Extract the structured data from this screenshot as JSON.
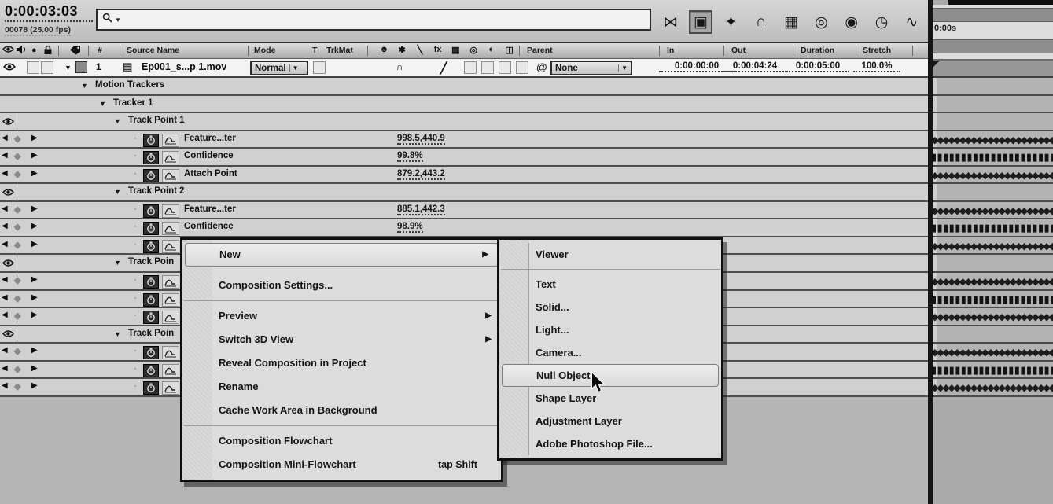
{
  "topbar": {
    "timecode": "0:00:03:03",
    "frames": "00078 (25.00 fps)",
    "search_placeholder": "",
    "tools": [
      {
        "name": "mini-flowchart-icon",
        "glyph": "⋈"
      },
      {
        "name": "live-update-icon",
        "glyph": "▣",
        "active": true
      },
      {
        "name": "draft-3d-icon",
        "glyph": "✦"
      },
      {
        "name": "shy-icon",
        "glyph": "∩"
      },
      {
        "name": "frame-blending-icon",
        "glyph": "▦"
      },
      {
        "name": "motion-blur-icon",
        "glyph": "◎"
      },
      {
        "name": "brainstorm-icon",
        "glyph": "◉"
      },
      {
        "name": "auto-keyframe-icon",
        "glyph": "◷"
      },
      {
        "name": "graph-editor-icon",
        "glyph": "∿"
      }
    ]
  },
  "columns": {
    "number": "#",
    "source_name": "Source Name",
    "mode": "Mode",
    "t": "T",
    "trkmat": "TrkMat",
    "parent": "Parent",
    "in": "In",
    "out": "Out",
    "duration": "Duration",
    "stretch": "Stretch",
    "switch_icons": [
      {
        "name": "shy-icon",
        "glyph": "☻"
      },
      {
        "name": "collapse-icon",
        "glyph": "✱"
      },
      {
        "name": "quality-icon",
        "glyph": "╲"
      },
      {
        "name": "fx-icon",
        "glyph": "fx"
      },
      {
        "name": "frame-blend-icon",
        "glyph": "▦"
      },
      {
        "name": "motion-blur-icon",
        "glyph": "◎"
      },
      {
        "name": "adjustment-layer-icon",
        "glyph": "◐"
      },
      {
        "name": "3d-layer-icon",
        "glyph": "◫"
      }
    ]
  },
  "layer": {
    "number": "1",
    "name": "Ep001_s...p 1.mov",
    "mode": "Normal",
    "parent": "None",
    "in": "0:00:00:00",
    "out": "0:00:04:24",
    "duration": "0:00:05:00",
    "stretch": "100.0%"
  },
  "rows": [
    {
      "type": "group",
      "level": 2,
      "label": "Motion Trackers"
    },
    {
      "type": "group",
      "level": 3,
      "label": "Tracker 1"
    },
    {
      "type": "group",
      "level": 4,
      "label": "Track Point 1",
      "eye": true
    },
    {
      "type": "prop",
      "label": "Feature...ter",
      "value": "998.5,440.9",
      "keyframes": "diamond"
    },
    {
      "type": "prop",
      "label": "Confidence",
      "value": "99.8%",
      "keyframes": "square"
    },
    {
      "type": "prop",
      "label": "Attach Point",
      "value": "879.2,443.2",
      "keyframes": "diamond"
    },
    {
      "type": "group",
      "level": 4,
      "label": "Track Point 2",
      "eye": true
    },
    {
      "type": "prop",
      "label": "Feature...ter",
      "value": "885.1,442.3",
      "keyframes": "diamond"
    },
    {
      "type": "prop",
      "label": "Confidence",
      "value": "98.9%",
      "keyframes": "square"
    },
    {
      "type": "prop",
      "label": "",
      "value": "",
      "keyframes": "diamond"
    },
    {
      "type": "group",
      "level": 4,
      "label": "Track Poin",
      "eye": true
    },
    {
      "type": "prop",
      "label": "",
      "value": "",
      "keyframes": "diamond"
    },
    {
      "type": "prop",
      "label": "",
      "value": "",
      "keyframes": "square"
    },
    {
      "type": "prop",
      "label": "",
      "value": "",
      "keyframes": "diamond"
    },
    {
      "type": "group",
      "level": 4,
      "label": "Track Poin",
      "eye": true
    },
    {
      "type": "prop",
      "label": "",
      "value": "",
      "keyframes": "diamond"
    },
    {
      "type": "prop",
      "label": "",
      "value": "",
      "keyframes": "square"
    },
    {
      "type": "prop",
      "label": "",
      "value": "",
      "keyframes": "diamond"
    }
  ],
  "context_menu": {
    "items": [
      {
        "label": "New",
        "submenu": true,
        "selected": true
      },
      {
        "separator": true
      },
      {
        "label": "Composition Settings..."
      },
      {
        "separator": true
      },
      {
        "label": "Preview",
        "submenu": true
      },
      {
        "label": "Switch 3D View",
        "submenu": true
      },
      {
        "label": "Reveal Composition in Project"
      },
      {
        "label": "Rename"
      },
      {
        "label": "Cache Work Area in Background"
      },
      {
        "separator": true
      },
      {
        "label": "Composition Flowchart"
      },
      {
        "label": "Composition Mini-Flowchart",
        "shortcut": "tap Shift"
      }
    ]
  },
  "submenu": {
    "items": [
      {
        "label": "Viewer"
      },
      {
        "separator": true
      },
      {
        "label": "Text"
      },
      {
        "label": "Solid..."
      },
      {
        "label": "Light..."
      },
      {
        "label": "Camera..."
      },
      {
        "label": "Null Object",
        "selected": true
      },
      {
        "label": "Shape Layer"
      },
      {
        "label": "Adjustment Layer"
      },
      {
        "label": "Adobe Photoshop File..."
      }
    ]
  },
  "ruler": {
    "label": "0:00s"
  },
  "colors": {
    "panel_bg": "#c9c9c9",
    "menu_bg": "#dcdcdc",
    "row_separator": "#4e4e4e",
    "keyframe": "#1d1d1d",
    "layer_row_bg": "#f3f3f3"
  }
}
